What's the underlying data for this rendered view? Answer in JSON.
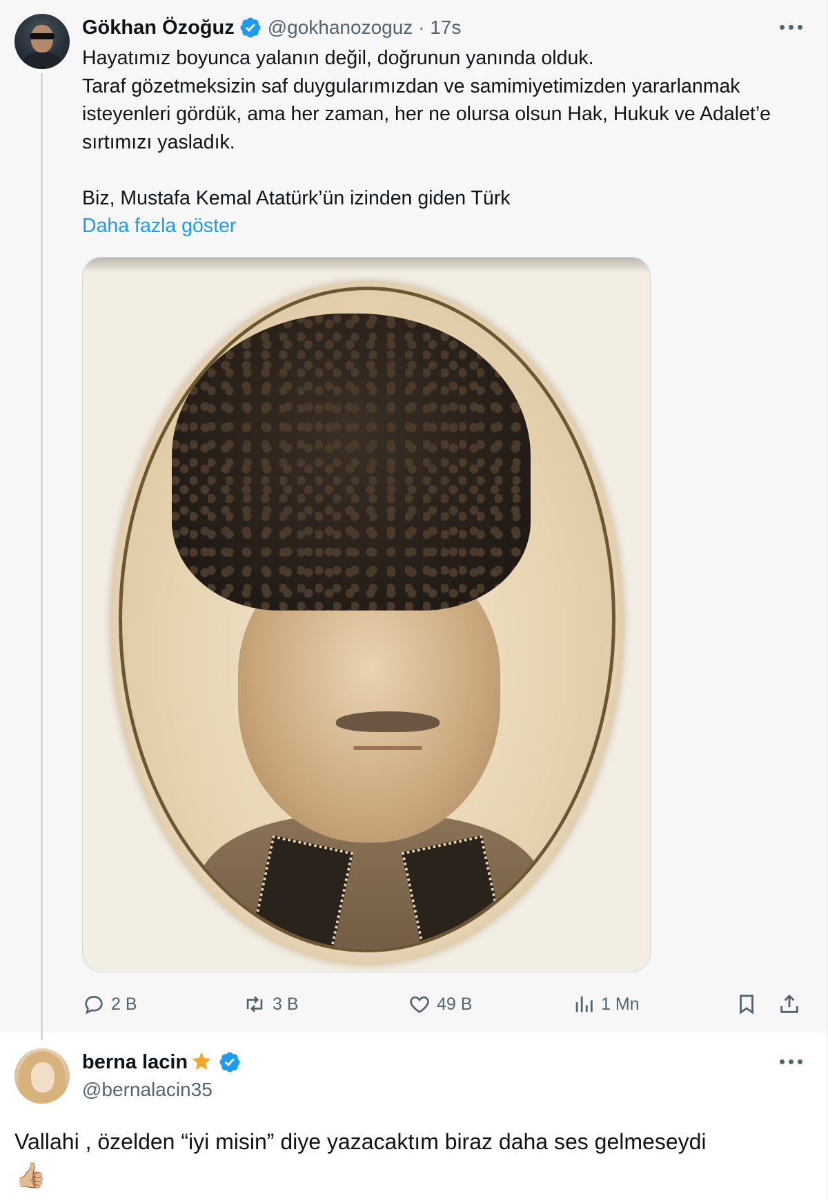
{
  "tweet": {
    "author_name": "Gökhan Özoğuz",
    "handle": "@gokhanozoguz",
    "separator": "·",
    "time": "17s",
    "text": "Hayatımız boyunca yalanın değil, doğrunun yanında olduk.\nTaraf gözetmeksizin saf duygularımızdan ve samimiyetimizden yararlanmak isteyenleri gördük, ama her zaman, her ne olursa olsun Hak, Hukuk ve Adalet’e sırtımızı yasladık.\n\nBiz, Mustafa Kemal Atatürk’ün izinden giden Türk",
    "show_more": "Daha fazla göster",
    "stats": {
      "replies": "2 B",
      "retweets": "3 B",
      "likes": "49 B",
      "views": "1 Mn"
    }
  },
  "reply": {
    "author_name": "berna lacin",
    "handle": "@bernalacin35",
    "text": "Vallahi , özelden “iyi misin” diye yazacaktım biraz daha ses gelmeseydi",
    "emoji": "👍🏼"
  },
  "colors": {
    "accent": "#1d9bf0",
    "secondary_text": "#536471",
    "star_badge": "#f5a623"
  },
  "icons": [
    "verified-badge-icon",
    "more-icon",
    "reply-icon",
    "retweet-icon",
    "like-icon",
    "views-icon",
    "bookmark-icon",
    "share-icon",
    "star-icon"
  ]
}
